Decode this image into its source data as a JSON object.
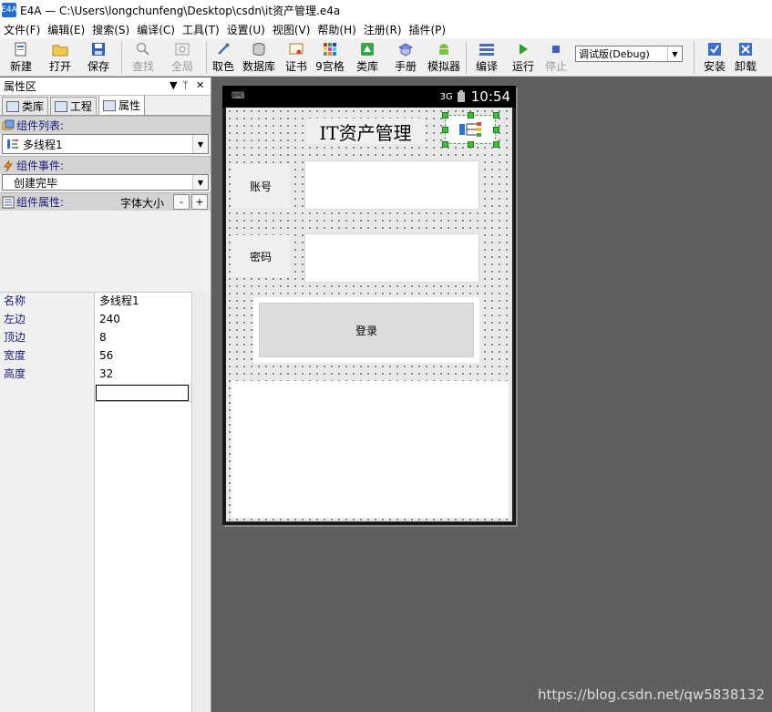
{
  "window": {
    "title": "E4A — C:\\Users\\longchunfeng\\Desktop\\csdn\\it资产管理.e4a",
    "icon_text": "E4A"
  },
  "menu": [
    "文件(F)",
    "编辑(E)",
    "搜索(S)",
    "编译(C)",
    "工具(T)",
    "设置(U)",
    "视图(V)",
    "帮助(H)",
    "注册(R)",
    "插件(P)"
  ],
  "toolbar": {
    "new": "新建",
    "open": "打开",
    "save": "保存",
    "find": "查找",
    "global": "全局",
    "pick_color": "取色",
    "database": "数据库",
    "certificate": "证书",
    "nine_grid": "9宫格",
    "library": "类库",
    "manual": "手册",
    "emulator": "模拟器",
    "compile": "编译",
    "run": "运行",
    "stop": "停止",
    "build_mode": "调试版(Debug)",
    "install": "安装",
    "uninstall": "卸载"
  },
  "panel": {
    "title": "属性区",
    "tabs": [
      "类库",
      "工程",
      "属性"
    ],
    "component_list_label": "组件列表:",
    "component_selected": "多线程1",
    "component_event_label": "组件事件:",
    "event_selected": "创建完毕",
    "component_props_label": "组件属性:",
    "font_size_label": "字体大小",
    "minus": "-",
    "plus": "+",
    "properties": [
      {
        "name": "名称",
        "value": "多线程1"
      },
      {
        "name": "左边",
        "value": "240"
      },
      {
        "name": "顶边",
        "value": "8"
      },
      {
        "name": "宽度",
        "value": "56"
      },
      {
        "name": "高度",
        "value": "32"
      }
    ]
  },
  "phone": {
    "clock": "10:54",
    "signal": "3G",
    "app_title": "IT资产管理",
    "account_label": "账号",
    "password_label": "密码",
    "login_button": "登录"
  },
  "watermark": "https://blog.csdn.net/qw5838132"
}
